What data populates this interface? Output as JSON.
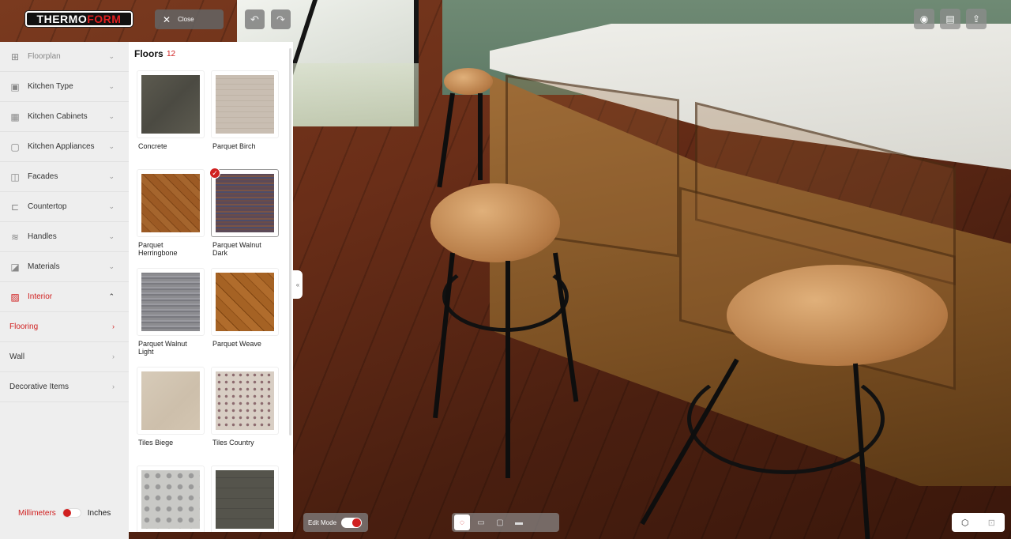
{
  "header": {
    "logo_text_a": "THERMO",
    "logo_text_b": "FORM",
    "close_label": "Close",
    "undo_icon": "undo-icon",
    "redo_icon": "redo-icon",
    "right_tools": [
      "camera-icon",
      "video-icon",
      "share-icon"
    ]
  },
  "sidebar": {
    "items": [
      {
        "label": "Floorplan",
        "icon": "floorplan-icon"
      },
      {
        "label": "Kitchen Type",
        "icon": "kitchen-type-icon"
      },
      {
        "label": "Kitchen Cabinets",
        "icon": "cabinets-icon"
      },
      {
        "label": "Kitchen Appliances",
        "icon": "appliances-icon"
      },
      {
        "label": "Facades",
        "icon": "facades-icon"
      },
      {
        "label": "Countertop",
        "icon": "countertop-icon"
      },
      {
        "label": "Handles",
        "icon": "handles-icon"
      },
      {
        "label": "Materials",
        "icon": "materials-icon"
      },
      {
        "label": "Interior",
        "icon": "interior-icon"
      }
    ],
    "subitems": [
      {
        "label": "Flooring"
      },
      {
        "label": "Wall"
      },
      {
        "label": "Decorative Items"
      }
    ],
    "units": {
      "left": "Millimeters",
      "right": "Inches"
    }
  },
  "panel": {
    "title": "Floors",
    "count": "12",
    "tiles": [
      {
        "label": "Concrete",
        "texture": "concrete"
      },
      {
        "label": "Parquet Birch",
        "texture": "birch"
      },
      {
        "label": "Parquet Herringbone",
        "texture": "herring"
      },
      {
        "label": "Parquet Walnut Dark",
        "texture": "walnutdark",
        "selected": true
      },
      {
        "label": "Parquet Walnut Light",
        "texture": "walnutlight"
      },
      {
        "label": "Parquet Weave",
        "texture": "weave"
      },
      {
        "label": "Tiles Biege",
        "texture": "biege"
      },
      {
        "label": "Tiles Country",
        "texture": "country"
      },
      {
        "label": "",
        "texture": "pattern"
      },
      {
        "label": "",
        "texture": "slate"
      }
    ]
  },
  "bottom": {
    "edit_mode_label": "Edit Mode",
    "view_buttons": [
      "lasso-icon",
      "rect-view-icon",
      "square-view-icon",
      "wide-view-icon"
    ],
    "mode_buttons": [
      "3d-view-icon",
      "2d-plan-icon"
    ]
  },
  "colors": {
    "accent": "#d02020",
    "sidebar_bg": "#eeeeee"
  }
}
